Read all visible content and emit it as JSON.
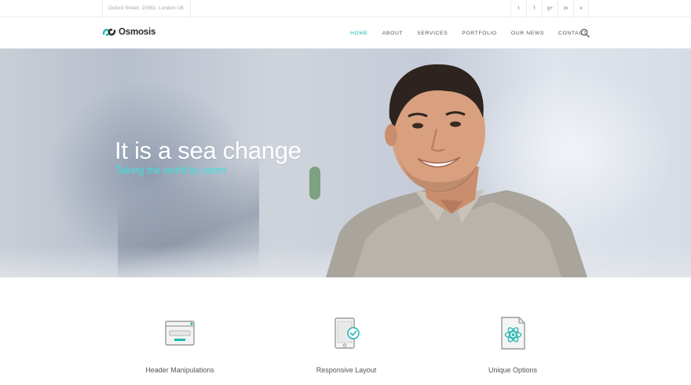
{
  "topbar": {
    "address": "Oxford Street, 15561, London UK",
    "social": [
      {
        "icon": "twitter-icon",
        "glyph": "t"
      },
      {
        "icon": "facebook-icon",
        "glyph": "f"
      },
      {
        "icon": "google-plus-icon",
        "glyph": "g+"
      },
      {
        "icon": "linkedin-icon",
        "glyph": "in"
      },
      {
        "icon": "vimeo-icon",
        "glyph": "v"
      }
    ]
  },
  "header": {
    "brand": "Osmosis",
    "nav": [
      {
        "label": "HOME",
        "active": true
      },
      {
        "label": "ABOUT",
        "active": false
      },
      {
        "label": "SERVICES",
        "active": false
      },
      {
        "label": "PORTFOLIO",
        "active": false
      },
      {
        "label": "OUR NEWS",
        "active": false
      },
      {
        "label": "CONTACT",
        "active": false
      }
    ],
    "search_icon": "search-icon"
  },
  "hero": {
    "title": "It is a sea change",
    "subtitle": "Taking the world by storm"
  },
  "features": [
    {
      "icon": "browser-window-icon",
      "label": "Header Manipulations"
    },
    {
      "icon": "tablet-check-icon",
      "label": "Responsive Layout"
    },
    {
      "icon": "atom-document-icon",
      "label": "Unique Options"
    }
  ],
  "colors": {
    "accent": "#1fb5b0",
    "hero_subtitle": "#3fe0dc",
    "text": "#555555"
  }
}
